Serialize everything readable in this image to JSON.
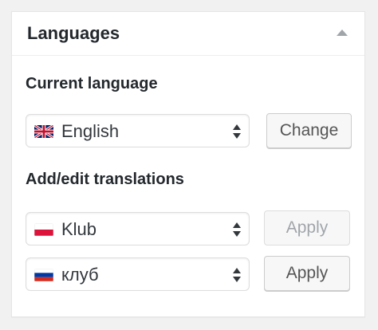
{
  "widget": {
    "title": "Languages"
  },
  "current_language": {
    "label": "Current language",
    "selected": "English",
    "flag": "uk-flag-icon",
    "button_label": "Change"
  },
  "translations": {
    "label": "Add/edit translations",
    "rows": [
      {
        "selected": "Klub",
        "flag": "poland-flag-icon",
        "button_label": "Apply",
        "button_enabled": false
      },
      {
        "selected": "клуб",
        "flag": "russia-flag-icon",
        "button_label": "Apply",
        "button_enabled": true
      }
    ]
  },
  "colors": {
    "background": "#f1f1f1",
    "panel": "#ffffff",
    "text": "#23282d",
    "disabled_text": "#a0a5aa"
  }
}
